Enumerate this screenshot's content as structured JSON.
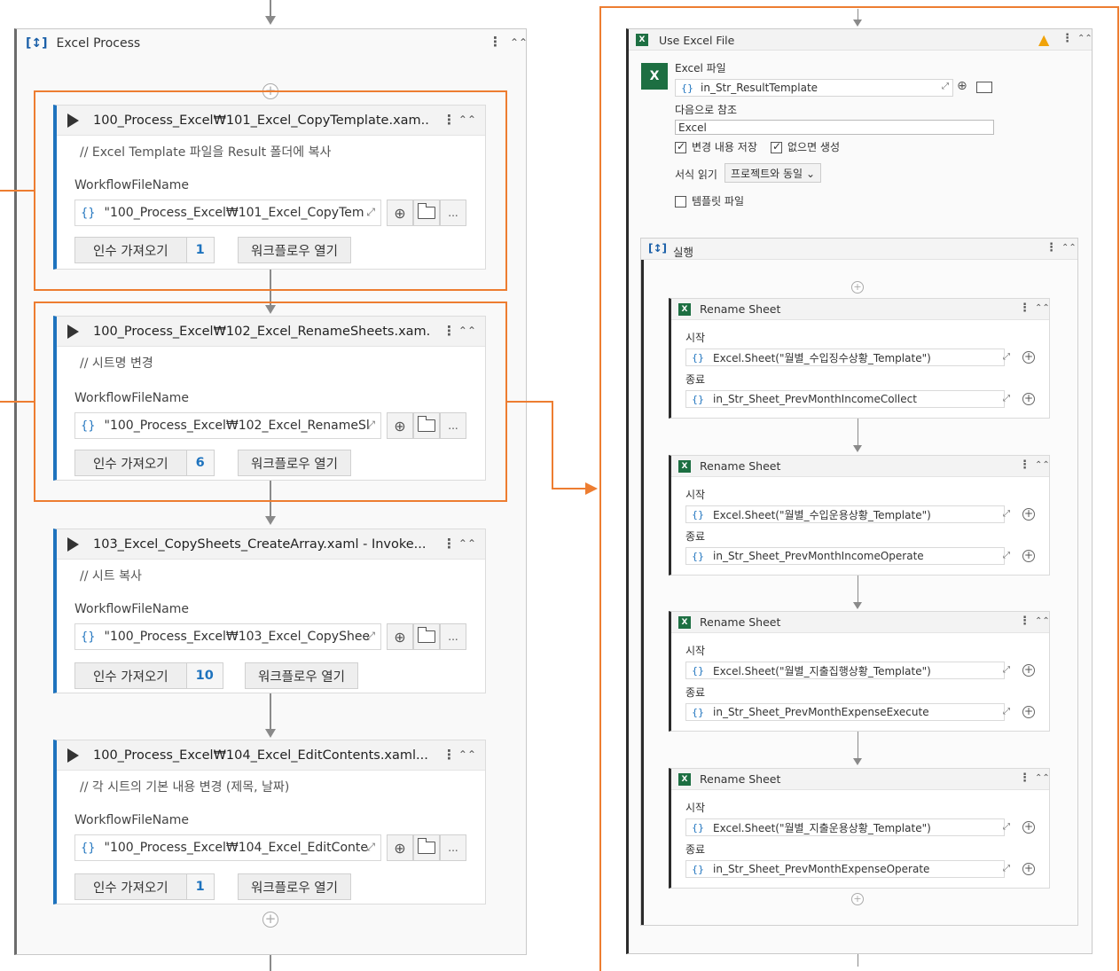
{
  "excel_process": {
    "title": "Excel Process",
    "invokes": [
      {
        "title": "100_Process_Excel₩101_Excel_CopyTemplate.xam...",
        "comment": "// Excel Template 파일을 Result 폴더에 복사",
        "workflow_label": "WorkflowFileName",
        "workflow_value": "\"100_Process_Excel₩101_Excel_CopyTem",
        "args_label": "인수 가져오기",
        "args_count": "1",
        "open_label": "워크플로우 열기"
      },
      {
        "title": "100_Process_Excel₩102_Excel_RenameSheets.xam...",
        "comment": "// 시트명 변경",
        "workflow_label": "WorkflowFileName",
        "workflow_value": "\"100_Process_Excel₩102_Excel_RenameSl",
        "args_label": "인수 가져오기",
        "args_count": "6",
        "open_label": "워크플로우 열기"
      },
      {
        "title": "103_Excel_CopySheets_CreateArray.xaml - Invoke...",
        "comment": "// 시트 복사",
        "workflow_label": "WorkflowFileName",
        "workflow_value": "\"100_Process_Excel₩103_Excel_CopyShee",
        "args_label": "인수 가져오기",
        "args_count": "10",
        "open_label": "워크플로우 열기"
      },
      {
        "title": "100_Process_Excel₩104_Excel_EditContents.xaml...",
        "comment": "// 각 시트의 기본 내용 변경 (제목, 날짜)",
        "workflow_label": "WorkflowFileName",
        "workflow_value": "\"100_Process_Excel₩104_Excel_EditConte",
        "args_label": "인수 가져오기",
        "args_count": "1",
        "open_label": "워크플로우 열기"
      }
    ]
  },
  "use_excel_file": {
    "title": "Use Excel File",
    "file_label": "Excel 파일",
    "file_value": "in_Str_ResultTemplate",
    "ref_label": "다음으로 참조",
    "ref_value": "Excel",
    "save_changes_label": "변경 내용 저장",
    "create_if_missing_label": "없으면 생성",
    "format_label": "서식 읽기",
    "format_value": "프로젝트와 동일",
    "template_label": "템플릿 파일",
    "do_title": "실행",
    "rename_sheets": [
      {
        "title": "Rename Sheet",
        "start_label": "시작",
        "start_value": "Excel.Sheet(\"월별_수입징수상황_Template\")",
        "end_label": "종료",
        "end_value": "in_Str_Sheet_PrevMonthIncomeCollect"
      },
      {
        "title": "Rename Sheet",
        "start_label": "시작",
        "start_value": "Excel.Sheet(\"월별_수입운용상황_Template\")",
        "end_label": "종료",
        "end_value": "in_Str_Sheet_PrevMonthIncomeOperate"
      },
      {
        "title": "Rename Sheet",
        "start_label": "시작",
        "start_value": "Excel.Sheet(\"월별_지출집행상황_Template\")",
        "end_label": "종료",
        "end_value": "in_Str_Sheet_PrevMonthExpenseExecute"
      },
      {
        "title": "Rename Sheet",
        "start_label": "시작",
        "start_value": "Excel.Sheet(\"월별_지출운용상황_Template\")",
        "end_label": "종료",
        "end_value": "in_Str_Sheet_PrevMonthExpenseOperate"
      }
    ]
  },
  "colors": {
    "highlight": "#ed7d31",
    "accent": "#1e73be",
    "excel_green": "#1d6f42",
    "warning": "#f0a30a"
  }
}
